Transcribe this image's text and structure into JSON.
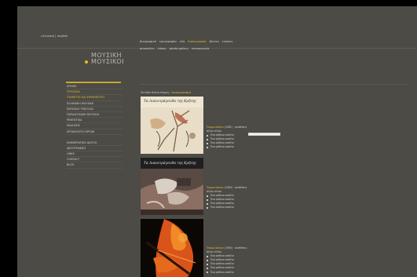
{
  "header": {
    "lang_switch": "ελληνικά | english",
    "logo": {
      "line1": "ΜΟΥΣΙΚΗ",
      "line2": "ΜΟΥΣΙΚΟΙ"
    }
  },
  "topnav": {
    "row1": [
      {
        "label": "βιογραφικό"
      },
      {
        "label": "εργογραφία"
      },
      {
        "label": "νέα"
      },
      {
        "label": "δισκογραφία",
        "active": true
      },
      {
        "label": "βίντεο"
      },
      {
        "label": "εικόνες"
      }
    ],
    "row2": [
      {
        "label": "συναυλίες"
      },
      {
        "label": "τύπος"
      },
      {
        "label": "photo gallery"
      },
      {
        "label": "επικοινωνία"
      }
    ]
  },
  "sidebar": {
    "group1": [
      {
        "label": "ΑΡΧΙΚΗ"
      },
      {
        "label": "ΠΡΟΣΩΠΑ",
        "gold": true
      },
      {
        "label": "ΣΥΝΘΕΤΕΣ ΚΑΙ ΕΡΜΗΝΕΥΤΕΣ",
        "gold": true
      },
      {
        "label": "ΕΛΛΗΝΙΚΗ ΜΟΥΣΙΚΗ"
      },
      {
        "label": "ΕΝΤΕΧΝΟ ΤΡΑΓΟΥΔΙ"
      },
      {
        "label": "ΠΑΡΑΔΟΣΙΑΚΗ ΜΟΥΣΙΚΗ"
      },
      {
        "label": "ΡΕΜΠΕΤΙΚΑ"
      },
      {
        "label": "ΕΚΔΟΣΕΙΣ"
      },
      {
        "label": "ΧΡΟΝΟΛΟΓΙΟ ΕΡΓΩΝ"
      }
    ],
    "group2": [
      {
        "label": "ΕΝΗΜΕΡΩΤΙΚΟ ΔΕΛΤΙΟ"
      },
      {
        "label": "ΦΩΤΟΓΡΑΦΙΕΣ"
      },
      {
        "label": "LINKS"
      },
      {
        "label": "CONTACT"
      },
      {
        "label": "BLOG"
      }
    ]
  },
  "breadcrumb": {
    "path": "Σελίδα Καλλιτέχνη ›",
    "current": "Δισκογραφία"
  },
  "albums": [
    {
      "artist": "Όνομα Δίσκου",
      "meta": "(1981) · συνθέσεις",
      "sub": "άλλοι τίτλοι",
      "tracks": [
        "Ένα ψάθινο καπέλο",
        "Ένα ψάθινο καπέλο",
        "Ένα ψάθινο καπέλο",
        "Ένα ψάθινο καπέλο"
      ],
      "cover_title": "Τα Λιανοτράγουδα της Κρήτης",
      "has_player": true
    },
    {
      "artist": "Όνομα Δίσκου",
      "meta": "(1983) · συνθέσεις",
      "sub": "άλλοι τίτλοι",
      "tracks": [
        "Ένα ψάθινο καπέλο",
        "Ένα ψάθινο καπέλο",
        "Ένα ψάθινο καπέλο",
        "Ένα ψάθινο καπέλο"
      ],
      "cover_title": "Τα Λιανοτράγουδα της Κρήτης"
    },
    {
      "artist": "Όνομα Δίσκου",
      "meta": "(1985) · συνθέσεις",
      "sub": "άλλοι τίτλοι",
      "tracks": [
        "Ένα ψάθινο καπέλο",
        "Ένα ψάθινο καπέλο",
        "Ένα ψάθινο καπέλο",
        "Ένα ψάθινο καπέλο",
        "Ένα ψάθινο καπέλο"
      ]
    }
  ],
  "colors": {
    "background": "#4c4b45",
    "accent": "#d9bb3c",
    "frame": "#000000"
  }
}
